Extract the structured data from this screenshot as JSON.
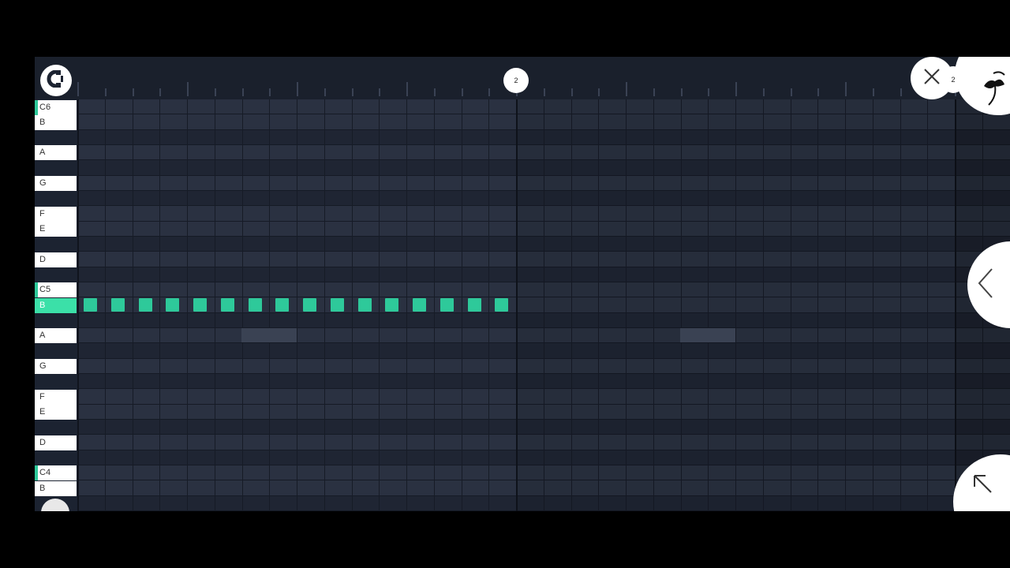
{
  "timeline": {
    "playhead_label": "2",
    "right_label": "2"
  },
  "piano_keys": [
    {
      "label": "C6",
      "type": "c"
    },
    {
      "label": "B",
      "type": "white"
    },
    {
      "label": "",
      "type": "black"
    },
    {
      "label": "A",
      "type": "white"
    },
    {
      "label": "",
      "type": "black"
    },
    {
      "label": "G",
      "type": "white"
    },
    {
      "label": "",
      "type": "black"
    },
    {
      "label": "F",
      "type": "white"
    },
    {
      "label": "E",
      "type": "white"
    },
    {
      "label": "",
      "type": "black"
    },
    {
      "label": "D",
      "type": "white"
    },
    {
      "label": "",
      "type": "black"
    },
    {
      "label": "C5",
      "type": "c"
    },
    {
      "label": "B",
      "type": "active"
    },
    {
      "label": "",
      "type": "black"
    },
    {
      "label": "A",
      "type": "white"
    },
    {
      "label": "",
      "type": "black"
    },
    {
      "label": "G",
      "type": "white"
    },
    {
      "label": "",
      "type": "black"
    },
    {
      "label": "F",
      "type": "white"
    },
    {
      "label": "E",
      "type": "white"
    },
    {
      "label": "",
      "type": "black"
    },
    {
      "label": "D",
      "type": "white"
    },
    {
      "label": "",
      "type": "black"
    },
    {
      "label": "C4",
      "type": "c"
    },
    {
      "label": "B",
      "type": "white"
    },
    {
      "label": "",
      "type": "black"
    }
  ],
  "notes": {
    "pitch": "B5",
    "start_steps": [
      0,
      1,
      2,
      3,
      4,
      5,
      6,
      7,
      8,
      9,
      10,
      11,
      12,
      13,
      14,
      15
    ],
    "length_steps": 0.5
  },
  "grid": {
    "steps_per_bar": 16,
    "visible_bars": 2.1
  },
  "colors": {
    "accent": "#2ec99a",
    "background": "#1c2331",
    "key_white": "#ffffff"
  },
  "icons": {
    "magnet": "magnet-icon",
    "close": "close-icon",
    "logo": "fl-studio-fruit-logo",
    "back": "chevron-left-icon",
    "expand": "arrow-up-left-icon"
  }
}
